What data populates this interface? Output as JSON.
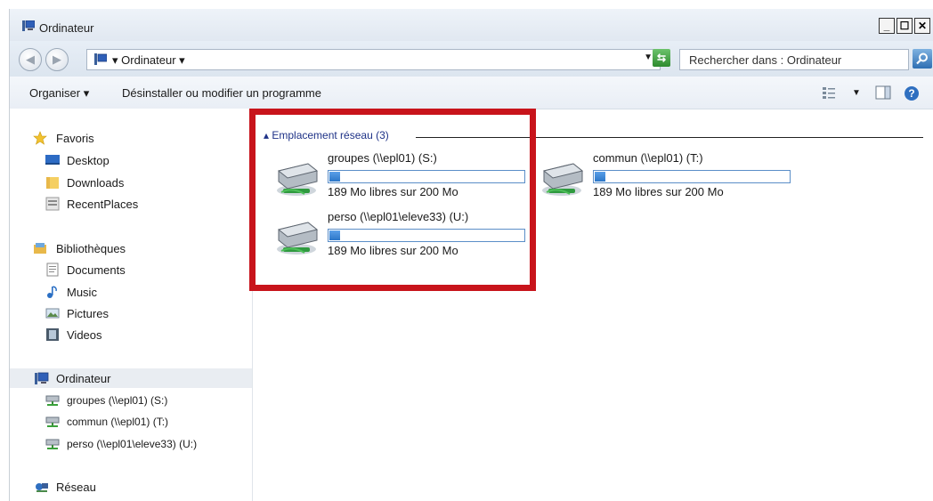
{
  "window": {
    "title": "Ordinateur"
  },
  "address": {
    "path": "Ordinateur",
    "search_placeholder": "Rechercher dans : Ordinateur"
  },
  "toolbar": {
    "organize": "Organiser",
    "uninstall": "Désinstaller ou modifier un programme"
  },
  "sidebar": {
    "favorites": {
      "label": "Favoris",
      "items": [
        {
          "label": "Desktop",
          "icon": "desktop-icon"
        },
        {
          "label": "Downloads",
          "icon": "folder-icon"
        },
        {
          "label": "RecentPlaces",
          "icon": "recent-places-icon"
        }
      ]
    },
    "libraries": {
      "label": "Bibliothèques",
      "items": [
        {
          "label": "Documents",
          "icon": "documents-icon"
        },
        {
          "label": "Music",
          "icon": "music-icon"
        },
        {
          "label": "Pictures",
          "icon": "pictures-icon"
        },
        {
          "label": "Videos",
          "icon": "videos-icon"
        }
      ]
    },
    "computer": {
      "label": "Ordinateur",
      "items": [
        {
          "label": "groupes (\\\\epl01) (S:)",
          "icon": "network-drive-icon"
        },
        {
          "label": "commun (\\\\epl01) (T:)",
          "icon": "network-drive-icon"
        },
        {
          "label": "perso (\\\\epl01\\eleve33) (U:)",
          "icon": "network-drive-icon"
        }
      ]
    },
    "network": {
      "label": "Réseau"
    }
  },
  "content": {
    "group_header": "Emplacement réseau (3)",
    "drives": [
      {
        "name": "groupes (\\\\epl01) (S:)",
        "free": "189 Mo libres sur 200 Mo",
        "used_fraction": 0.055
      },
      {
        "name": "commun (\\\\epl01) (T:)",
        "free": "189 Mo libres sur 200 Mo",
        "used_fraction": 0.055
      },
      {
        "name": "perso (\\\\epl01\\eleve33) (U:)",
        "free": "189 Mo libres sur 200 Mo",
        "used_fraction": 0.055
      }
    ]
  },
  "colors": {
    "highlight": "#c8141b",
    "bar_fill": "#2c76c8",
    "group_header": "#1e3287"
  }
}
